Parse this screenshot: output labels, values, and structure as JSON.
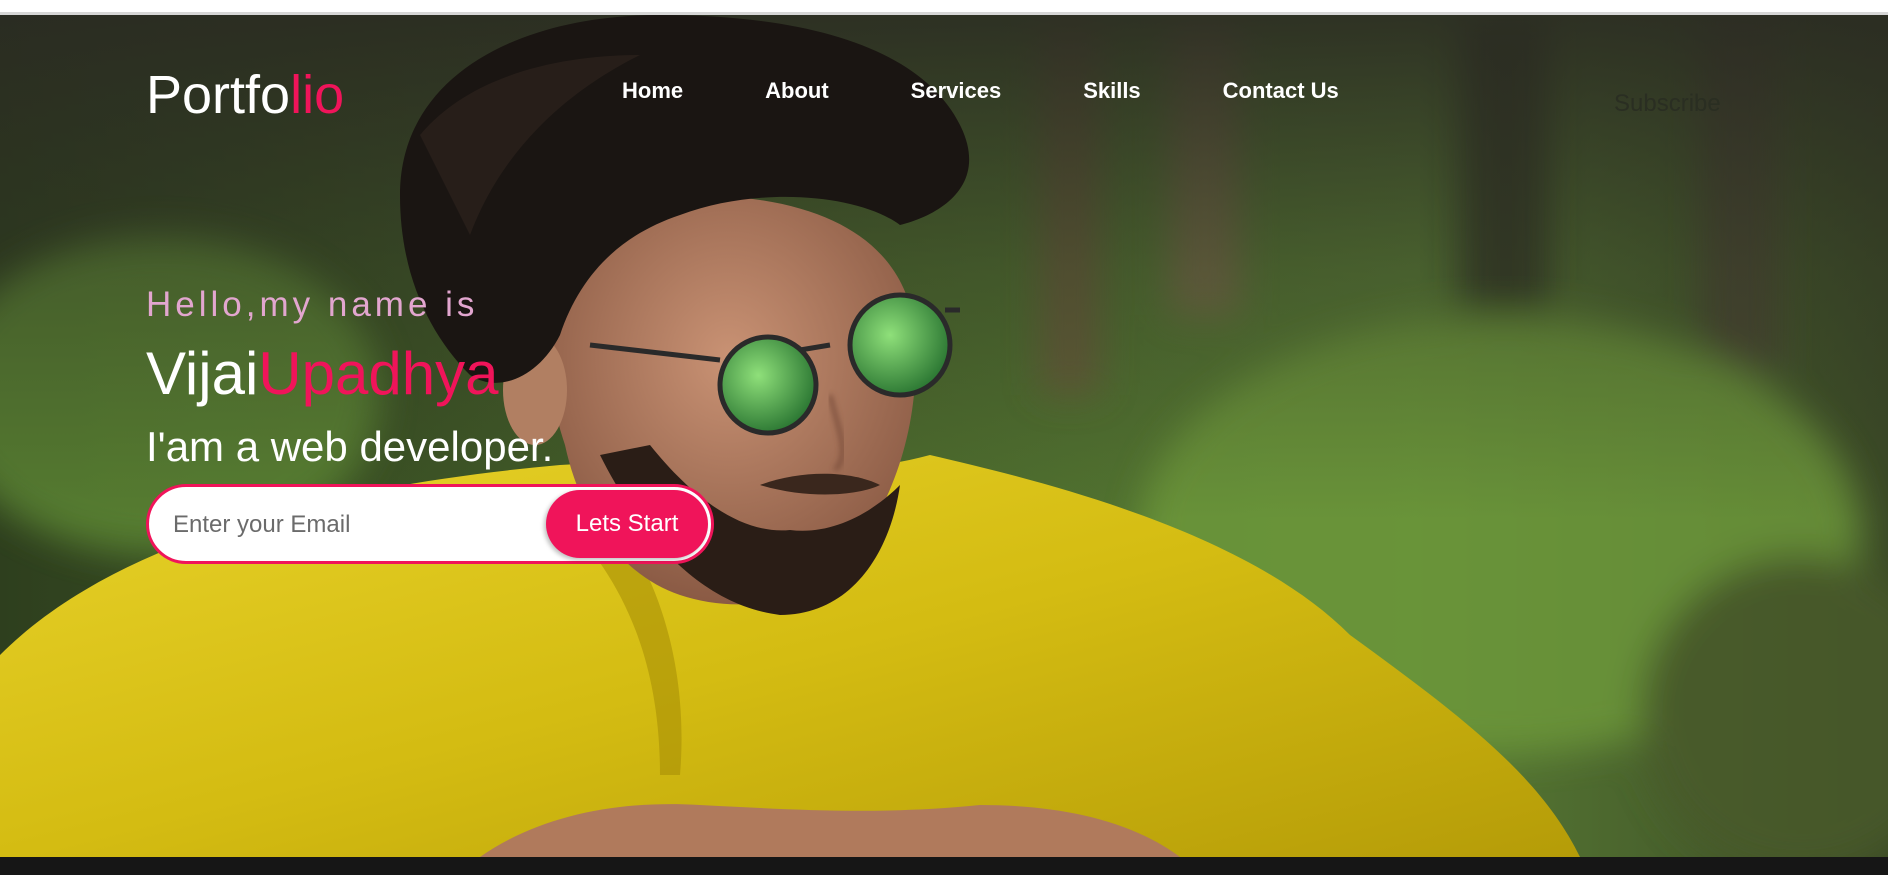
{
  "header": {
    "logo_main": "Portfo",
    "logo_accent": "lio",
    "nav": [
      {
        "label": "Home"
      },
      {
        "label": "About"
      },
      {
        "label": "Services"
      },
      {
        "label": "Skills"
      },
      {
        "label": "Contact Us"
      }
    ],
    "subscribe_label": "Subscribe"
  },
  "hero": {
    "greeting": "Hello,my name is",
    "first_name": "Vijai",
    "last_name": "Upadhya",
    "role": "I'am a web developer.",
    "email_placeholder": "Enter your Email",
    "cta_label": "Lets Start",
    "photo_icon": "portrait-photo"
  },
  "colors": {
    "accent": "#f0145a",
    "greeting": "#e2a6cf",
    "text": "#ffffff",
    "footer": "#161616"
  }
}
